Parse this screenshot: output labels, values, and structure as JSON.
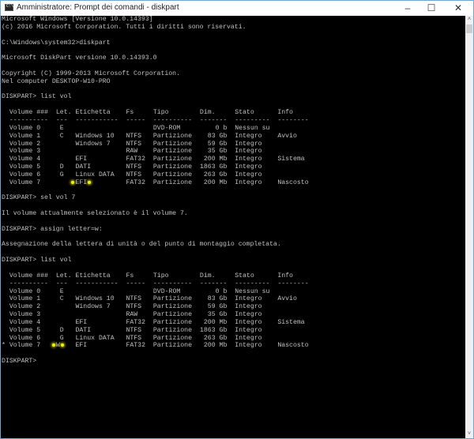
{
  "window": {
    "title": "Amministratore: Prompt dei comandi - diskpart",
    "minimize": "–",
    "maximize": "☐",
    "close": "✕"
  },
  "scrollbar": {
    "up": "˄",
    "down": "˅",
    "position_fraction": 0.0
  },
  "highlight_color": "#f3f300",
  "preamble": [
    "Microsoft Windows [Versione 10.0.14393]",
    "(c) 2016 Microsoft Corporation. Tutti i diritti sono riservati.",
    "",
    "C:\\Windows\\system32>diskpart",
    "",
    "Microsoft DiskPart versione 10.0.14393.0",
    "",
    "Copyright (C) 1999-2013 Microsoft Corporation.",
    "Nel computer DESKTOP-W10-PRO",
    "",
    "DISKPART> list vol",
    ""
  ],
  "columns": [
    "Volume ###",
    "Let.",
    "Etichetta",
    "Fs",
    "Tipo",
    "Dim.",
    "Stato",
    "Info"
  ],
  "separators": [
    "----------",
    "---",
    "-----------",
    "-----",
    "----------",
    "-------",
    "---------",
    "--------"
  ],
  "table1": [
    {
      "sel": "",
      "vol": "Volume 0",
      "let": "E",
      "label": "",
      "fs": "",
      "type": "DVD-ROM",
      "size": "0 b",
      "status": "Nessun su",
      "info": ""
    },
    {
      "sel": "",
      "vol": "Volume 1",
      "let": "C",
      "label": "Windows 10",
      "fs": "NTFS",
      "type": "Partizione",
      "size": "83 Gb",
      "status": "Integro",
      "info": "Avvio"
    },
    {
      "sel": "",
      "vol": "Volume 2",
      "let": "",
      "label": "Windows 7",
      "fs": "NTFS",
      "type": "Partizione",
      "size": "59 Gb",
      "status": "Integro",
      "info": ""
    },
    {
      "sel": "",
      "vol": "Volume 3",
      "let": "",
      "label": "",
      "fs": "RAW",
      "type": "Partizione",
      "size": "35 Gb",
      "status": "Integro",
      "info": ""
    },
    {
      "sel": "",
      "vol": "Volume 4",
      "let": "",
      "label": "EFI",
      "fs": "FAT32",
      "type": "Partizione",
      "size": "200 Mb",
      "status": "Integro",
      "info": "Sistema"
    },
    {
      "sel": "",
      "vol": "Volume 5",
      "let": "D",
      "label": "DATI",
      "fs": "NTFS",
      "type": "Partizione",
      "size": "1863 Gb",
      "status": "Integro",
      "info": ""
    },
    {
      "sel": "",
      "vol": "Volume 6",
      "let": "G",
      "label": "Linux DATA",
      "fs": "NTFS",
      "type": "Partizione",
      "size": "263 Gb",
      "status": "Integro",
      "info": ""
    },
    {
      "sel": "",
      "vol": "Volume 7",
      "let": "",
      "label": "EFI",
      "fs": "FAT32",
      "type": "Partizione",
      "size": "200 Mb",
      "status": "Integro",
      "info": "Nascosto",
      "hl": "label"
    }
  ],
  "middle": [
    "",
    "DISKPART> sel vol 7",
    "",
    "Il volume attualmente selezionato è il volume 7.",
    "",
    "DISKPART> assign letter=w:",
    "",
    "Assegnazione della lettera di unità o del punto di montaggio completata.",
    "",
    "DISKPART> list vol",
    ""
  ],
  "table2": [
    {
      "sel": "",
      "vol": "Volume 0",
      "let": "E",
      "label": "",
      "fs": "",
      "type": "DVD-ROM",
      "size": "0 b",
      "status": "Nessun su",
      "info": ""
    },
    {
      "sel": "",
      "vol": "Volume 1",
      "let": "C",
      "label": "Windows 10",
      "fs": "NTFS",
      "type": "Partizione",
      "size": "83 Gb",
      "status": "Integro",
      "info": "Avvio"
    },
    {
      "sel": "",
      "vol": "Volume 2",
      "let": "",
      "label": "Windows 7",
      "fs": "NTFS",
      "type": "Partizione",
      "size": "59 Gb",
      "status": "Integro",
      "info": ""
    },
    {
      "sel": "",
      "vol": "Volume 3",
      "let": "",
      "label": "",
      "fs": "RAW",
      "type": "Partizione",
      "size": "35 Gb",
      "status": "Integro",
      "info": ""
    },
    {
      "sel": "",
      "vol": "Volume 4",
      "let": "",
      "label": "EFI",
      "fs": "FAT32",
      "type": "Partizione",
      "size": "200 Mb",
      "status": "Integro",
      "info": "Sistema"
    },
    {
      "sel": "",
      "vol": "Volume 5",
      "let": "D",
      "label": "DATI",
      "fs": "NTFS",
      "type": "Partizione",
      "size": "1863 Gb",
      "status": "Integro",
      "info": ""
    },
    {
      "sel": "",
      "vol": "Volume 6",
      "let": "G",
      "label": "Linux DATA",
      "fs": "NTFS",
      "type": "Partizione",
      "size": "263 Gb",
      "status": "Integro",
      "info": ""
    },
    {
      "sel": "*",
      "vol": "Volume 7",
      "let": "W",
      "label": "EFI",
      "fs": "FAT32",
      "type": "Partizione",
      "size": "200 Mb",
      "status": "Integro",
      "info": "Nascosto",
      "hl": "let"
    }
  ],
  "prompt": "DISKPART> "
}
